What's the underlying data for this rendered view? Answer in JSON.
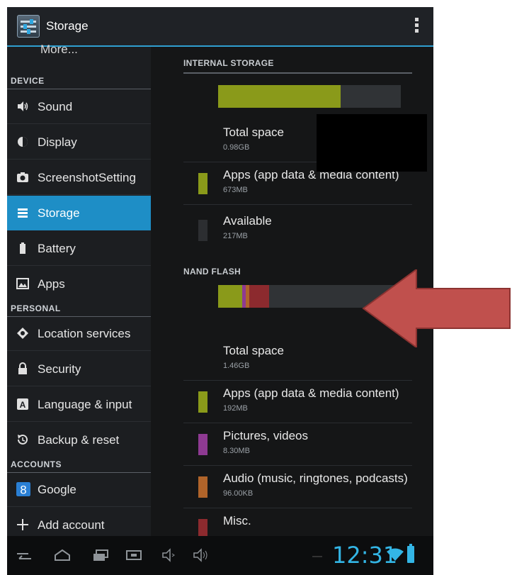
{
  "actionbar": {
    "title": "Storage",
    "icon": "settings-app-icon",
    "menu_icon": "overflow-menu-icon"
  },
  "left": {
    "more_label": "More...",
    "sections": {
      "device": "DEVICE",
      "personal": "PERSONAL",
      "accounts": "ACCOUNTS"
    },
    "items": [
      {
        "label": "Sound",
        "icon": "sound-icon"
      },
      {
        "label": "Display",
        "icon": "display-icon"
      },
      {
        "label": "ScreenshotSetting",
        "icon": "camera-icon"
      },
      {
        "label": "Storage",
        "icon": "storage-icon",
        "selected": true
      },
      {
        "label": "Battery",
        "icon": "battery-icon"
      },
      {
        "label": "Apps",
        "icon": "apps-icon"
      },
      {
        "label": "Location services",
        "icon": "location-icon"
      },
      {
        "label": "Security",
        "icon": "lock-icon"
      },
      {
        "label": "Language & input",
        "icon": "keyboard-icon"
      },
      {
        "label": "Backup & reset",
        "icon": "backup-icon"
      },
      {
        "label": "Google",
        "icon": "google-icon"
      },
      {
        "label": "Add account",
        "icon": "plus-icon"
      }
    ]
  },
  "internal": {
    "header": "INTERNAL STORAGE",
    "usage": [
      {
        "name": "Apps",
        "fraction": 0.67,
        "color": "#8a9a1a"
      }
    ],
    "total": {
      "title": "Total space",
      "value": "0.98GB"
    },
    "apps": {
      "title": "Apps (app data & media content)",
      "value": "673MB",
      "color": "#8a9a1a"
    },
    "available": {
      "title": "Available",
      "value": "217MB",
      "color": "#2c2e31"
    }
  },
  "nand": {
    "header": "NAND FLASH",
    "usage": [
      {
        "name": "Apps",
        "fraction": 0.13,
        "color": "#8a9a1a"
      },
      {
        "name": "Pictures, videos",
        "fraction": 0.02,
        "color": "#8e3a92"
      },
      {
        "name": "Audio",
        "fraction": 0.02,
        "color": "#b0642a"
      },
      {
        "name": "Misc.",
        "fraction": 0.11,
        "color": "#8c2a2e"
      }
    ],
    "total": {
      "title": "Total space",
      "value": "1.46GB"
    },
    "apps": {
      "title": "Apps (app data & media content)",
      "value": "192MB",
      "color": "#8a9a1a"
    },
    "pictures": {
      "title": "Pictures, videos",
      "value": "8.30MB",
      "color": "#8e3a92"
    },
    "audio": {
      "title": "Audio (music, ringtones, podcasts)",
      "value": "96.00KB",
      "color": "#b0642a"
    },
    "misc": {
      "title": "Misc.",
      "color": "#8c2a2e"
    }
  },
  "statusbar": {
    "time": "12:31",
    "wifi_icon": "wifi-icon",
    "battery_icon": "battery-status-icon"
  },
  "colors": {
    "accent": "#33b5e5",
    "selected": "#1e8ec6",
    "annotation_arrow": "#c0504d"
  }
}
